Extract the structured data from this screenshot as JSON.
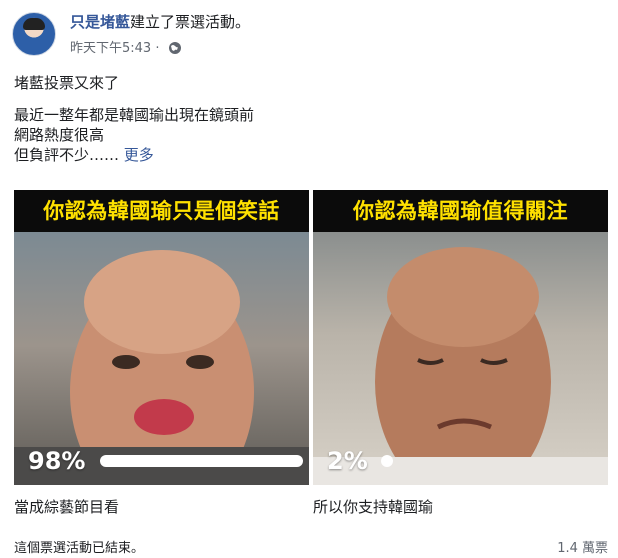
{
  "post": {
    "author": "只是堵藍",
    "action": "建立了票選活動。",
    "timestamp": "昨天下午5:43",
    "privacy_icon": "globe-icon",
    "lines": [
      "堵藍投票又來了",
      "最近一整年都是韓國瑜出現在鏡頭前",
      "網路熱度很高",
      "但負評不少……"
    ],
    "see_more": "更多"
  },
  "poll": {
    "options": [
      {
        "caption": "你認為韓國瑜只是個笑話",
        "percent_label": "98%",
        "percent": 98,
        "label": "當成綜藝節目看"
      },
      {
        "caption": "你認為韓國瑜值得關注",
        "percent_label": "2%",
        "percent": 2,
        "label": "所以你支持韓國瑜"
      }
    ],
    "status": "這個票選活動已結束。",
    "vote_count": "1.4 萬票"
  },
  "colors": {
    "link": "#365899",
    "caption_text": "#ffe100",
    "caption_bg": "#0b0b0b"
  }
}
